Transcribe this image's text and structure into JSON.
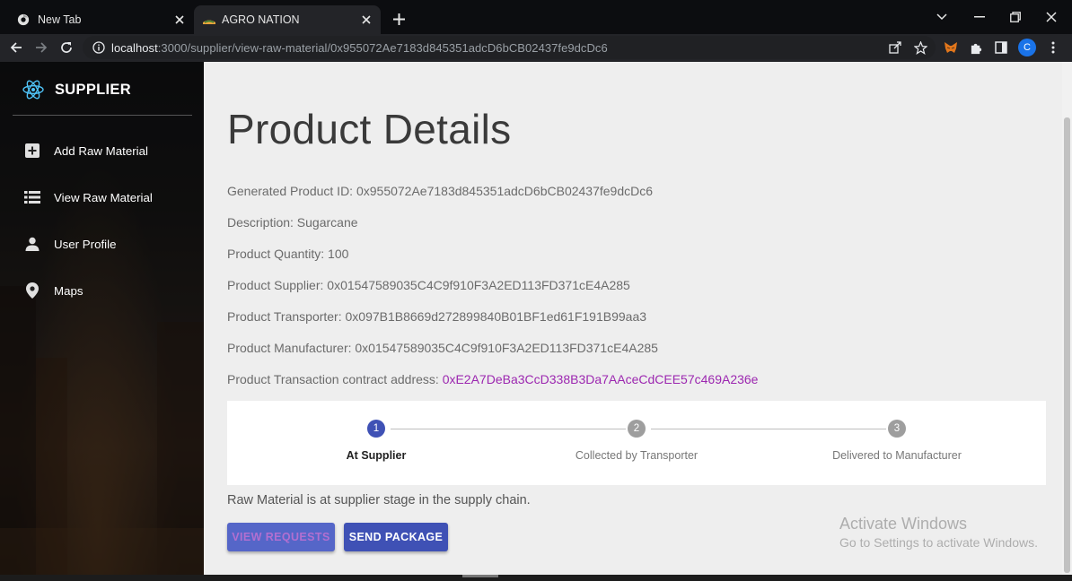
{
  "browser": {
    "tabs": [
      {
        "title": "New Tab",
        "icon": "chrome-icon"
      },
      {
        "title": "AGRO NATION",
        "icon": "site-favicon"
      }
    ],
    "url_host": "localhost",
    "url_rest": ":3000/supplier/view-raw-material/0x955072Ae7183d845351adcD6bCB02437fe9dcDc6",
    "profile_initial": "C"
  },
  "sidebar": {
    "brand": "SUPPLIER",
    "items": [
      {
        "label": "Add Raw Material",
        "icon": "add-box-icon"
      },
      {
        "label": "View Raw Material",
        "icon": "list-icon"
      },
      {
        "label": "User Profile",
        "icon": "person-icon"
      },
      {
        "label": "Maps",
        "icon": "location-pin-icon"
      }
    ]
  },
  "main": {
    "title": "Product Details",
    "details": {
      "product_id": "Generated Product ID: 0x955072Ae7183d845351adcD6bCB02437fe9dcDc6",
      "description": "Description: Sugarcane",
      "quantity": "Product Quantity: 100",
      "supplier": "Product Supplier: 0x01547589035C4C9f910F3A2ED113FD371cE4A285",
      "transporter": "Product Transporter: 0x097B1B8669d272899840B01BF1ed61F191B99aa3",
      "manufacturer": "Product Manufacturer: 0x01547589035C4C9f910F3A2ED113FD371cE4A285",
      "contract_label": "Product Transaction contract address: ",
      "contract_address": "0xE2A7DeBa3CcD338B3Da7AAceCdCEE57c469A236e"
    },
    "steps": [
      {
        "number": "1",
        "label": "At Supplier",
        "active": true
      },
      {
        "number": "2",
        "label": "Collected by Transporter",
        "active": false
      },
      {
        "number": "3",
        "label": "Delivered to Manufacturer",
        "active": false
      }
    ],
    "stage_text": "Raw Material is at supplier stage in the supply chain.",
    "buttons": {
      "view_requests": "VIEW REQUESTS",
      "send_package": "SEND PACKAGE"
    },
    "watermark": {
      "title": "Activate Windows",
      "subtitle": "Go to Settings to activate Windows."
    }
  },
  "colors": {
    "primary": "#3f51b5",
    "link": "#9c27b0",
    "inactive_step": "#9e9e9e"
  }
}
